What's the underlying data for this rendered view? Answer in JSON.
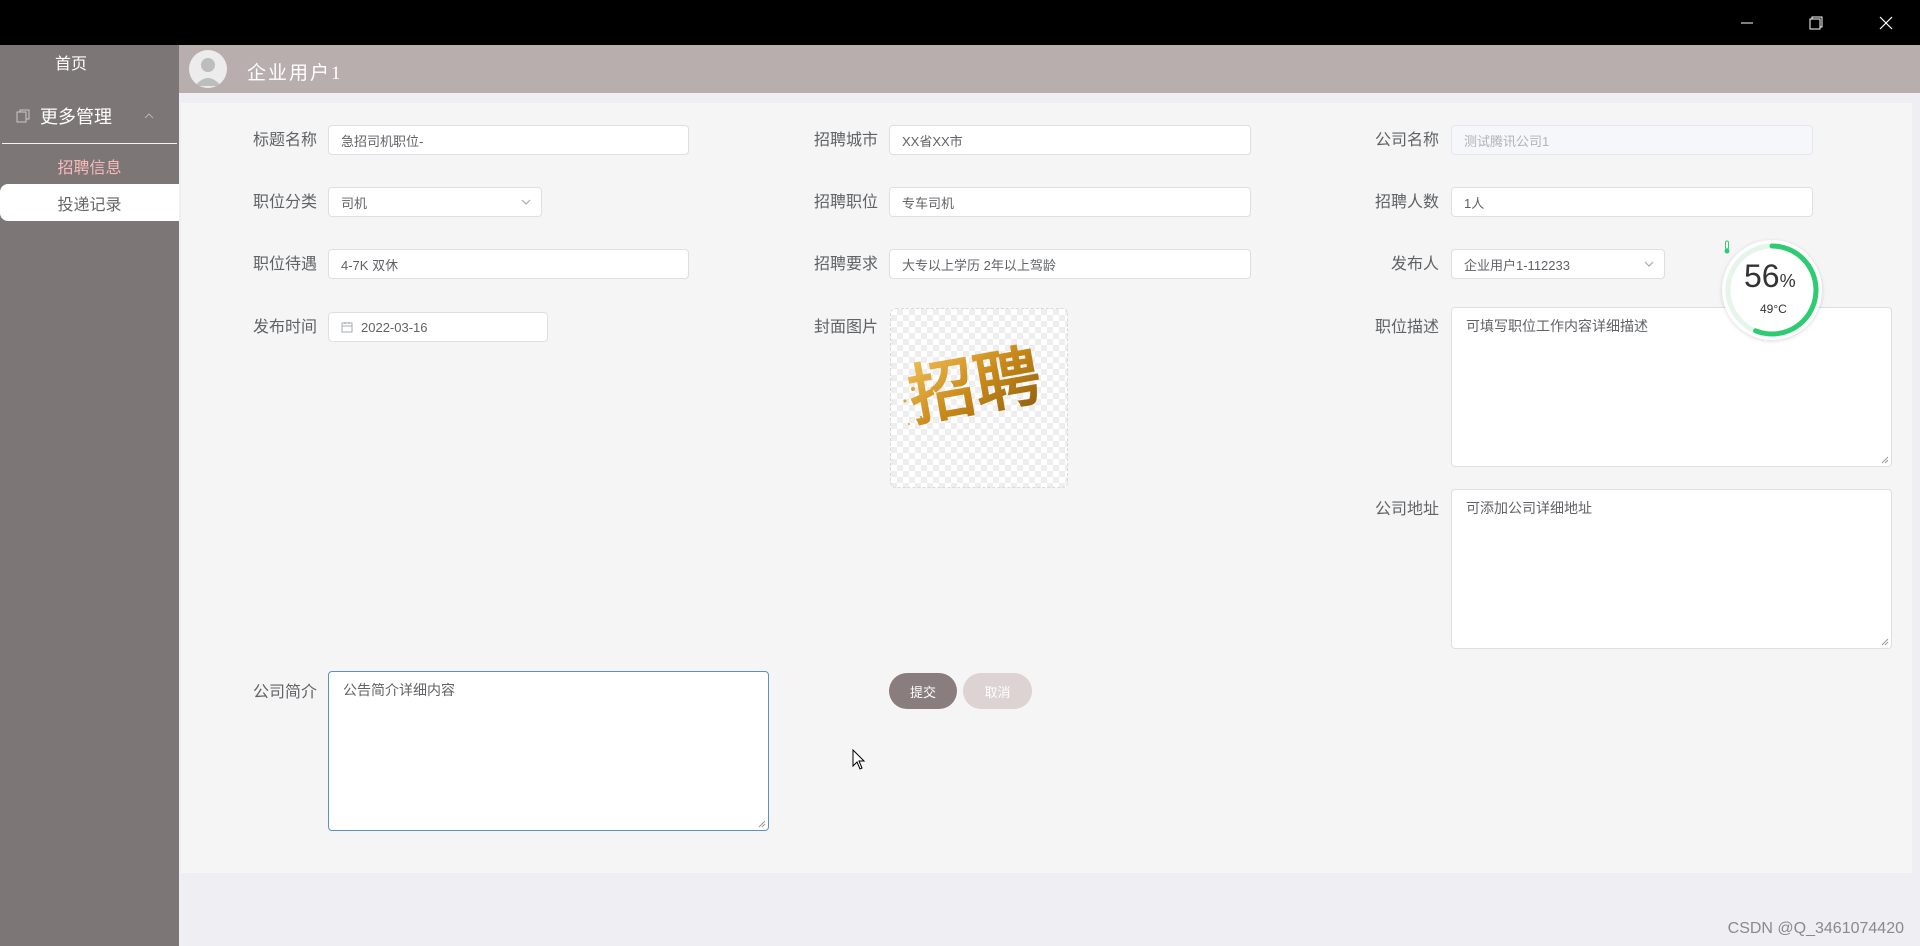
{
  "window": {
    "controls": [
      "minimize",
      "restore",
      "close"
    ]
  },
  "sidebar": {
    "home": "首页",
    "group": {
      "label": "更多管理",
      "icon": "copy-icon"
    },
    "items": [
      {
        "label": "招聘信息",
        "state": "active"
      },
      {
        "label": "投递记录",
        "state": "selected"
      }
    ]
  },
  "header": {
    "user": "企业用户1"
  },
  "form": {
    "title": {
      "label": "标题名称",
      "value": "急招司机职位-"
    },
    "city": {
      "label": "招聘城市",
      "value": "XX省XX市"
    },
    "company_name": {
      "label": "公司名称",
      "value": "测试腾讯公司1"
    },
    "category": {
      "label": "职位分类",
      "value": "司机"
    },
    "position": {
      "label": "招聘职位",
      "value": "专车司机"
    },
    "headcount": {
      "label": "招聘人数",
      "value": "1人"
    },
    "salary": {
      "label": "职位待遇",
      "value": "4-7K 双休"
    },
    "requirement": {
      "label": "招聘要求",
      "value": "大专以上学历 2年以上驾龄"
    },
    "publisher": {
      "label": "发布人",
      "value": "企业用户1-112233"
    },
    "publish_time": {
      "label": "发布时间",
      "value": "2022-03-16"
    },
    "cover": {
      "label": "封面图片",
      "art_text": "招聘"
    },
    "job_desc": {
      "label": "职位描述",
      "value": "可填写职位工作内容详细描述"
    },
    "address": {
      "label": "公司地址",
      "value": "可添加公司详细地址"
    },
    "intro": {
      "label": "公司简介",
      "value": "公告简介详细内容"
    },
    "submit": "提交",
    "cancel": "取消"
  },
  "gauge": {
    "percent": "56",
    "percent_sign": "%",
    "temperature": "49°C",
    "color": "#2ecc71"
  },
  "watermark": "CSDN @Q_3461074420",
  "colors": {
    "sidebar": "#7d7676",
    "header": "#b8aeae",
    "submit": "#8a7d7d",
    "cancel": "#ddd3d3",
    "active_nav_text": "#f9b9b9"
  }
}
